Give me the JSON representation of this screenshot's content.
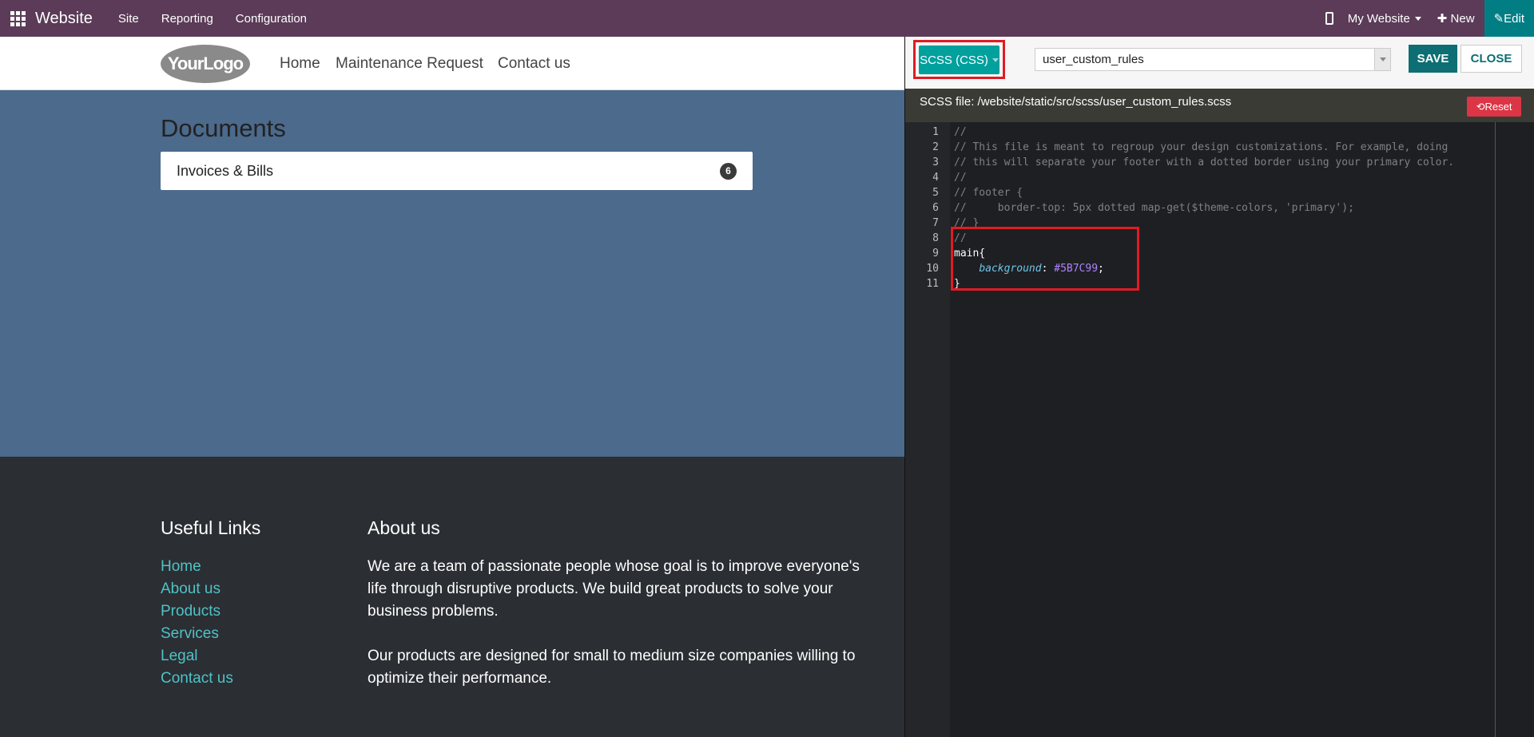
{
  "topbar": {
    "brand": "Website",
    "menu": [
      "Site",
      "Reporting",
      "Configuration"
    ],
    "website_selector": "My Website",
    "new_label": "New",
    "edit_label": "Edit"
  },
  "site": {
    "logo_text": "YourLogo",
    "nav": [
      "Home",
      "Maintenance Request",
      "Contact us"
    ],
    "documents_title": "Documents",
    "documents": [
      {
        "label": "Invoices & Bills",
        "count": "6"
      }
    ]
  },
  "footer": {
    "useful_links_title": "Useful Links",
    "links": [
      "Home",
      "About us",
      "Products",
      "Services",
      "Legal",
      "Contact us"
    ],
    "about_title": "About us",
    "about_p1": "We are a team of passionate people whose goal is to improve everyone's life through disruptive products. We build great products to solve your business problems.",
    "about_p2": "Our products are designed for small to medium size companies willing to optimize their performance."
  },
  "editor": {
    "type_label": "SCSS (CSS)",
    "file_value": "user_custom_rules",
    "save_label": "SAVE",
    "close_label": "CLOSE",
    "file_path": "SCSS file: /website/static/src/scss/user_custom_rules.scss",
    "reset_label": "Reset",
    "lines": [
      {
        "n": "1",
        "text": "//"
      },
      {
        "n": "2",
        "text": "// This file is meant to regroup your design customizations. For example, doing"
      },
      {
        "n": "3",
        "text": "// this will separate your footer with a dotted border using your primary color."
      },
      {
        "n": "4",
        "text": "//"
      },
      {
        "n": "5",
        "text": "// footer {"
      },
      {
        "n": "6",
        "text": "//     border-top: 5px dotted map-get($theme-colors, 'primary');"
      },
      {
        "n": "7",
        "text": "// }"
      },
      {
        "n": "8",
        "text": "//"
      },
      {
        "n": "9",
        "text": "main{"
      },
      {
        "n": "10",
        "prop": "background",
        "value": "#5B7C99"
      },
      {
        "n": "11",
        "text": "}"
      }
    ]
  },
  "colors": {
    "topbar": "#5b3b58",
    "main_bg": "#4b6a8c",
    "accent": "#00a09d",
    "highlight": "#e01b24"
  }
}
